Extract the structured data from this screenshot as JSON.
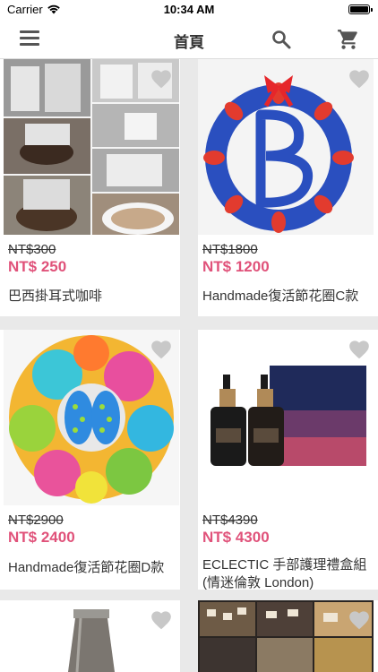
{
  "status": {
    "carrier": "Carrier",
    "time": "10:34 AM"
  },
  "nav": {
    "title": "首頁"
  },
  "products": [
    {
      "original_price": "NT$300",
      "price": "NT$ 250",
      "name": "巴西掛耳式咖啡"
    },
    {
      "original_price": "NT$1800",
      "price": "NT$ 1200",
      "name": "Handmade復活節花圈C款"
    },
    {
      "original_price": "NT$2900",
      "price": "NT$ 2400",
      "name": "Handmade復活節花圈D款"
    },
    {
      "original_price": "NT$4390",
      "price": "NT$ 4300",
      "name": "ECLECTIC 手部護理禮盒組 (情迷倫敦 London)"
    }
  ],
  "colors": {
    "price": "#e0527a",
    "background": "#e9e9e9"
  }
}
